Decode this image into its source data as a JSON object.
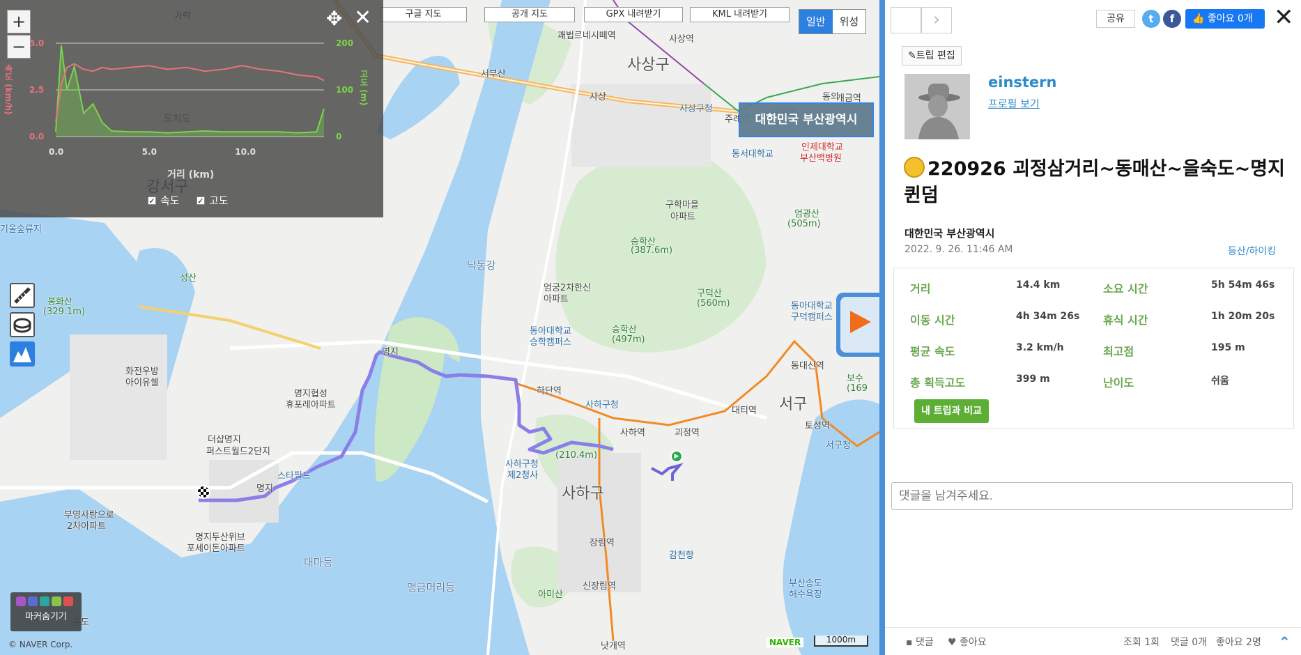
{
  "map": {
    "top_buttons": [
      "구글 지도",
      "공개 지도",
      "GPX 내려받기",
      "KML 내려받기"
    ],
    "map_type": {
      "normal": "일반",
      "satellite": "위성"
    },
    "place_badge": "대한민국 부산광역시",
    "marker_toggle_label": "마커숨기기",
    "copyright": "© NAVER Corp.",
    "naver_logo": "NAVER",
    "scale": "1000m",
    "zoom_in": "+",
    "zoom_out": "−",
    "labels": [
      {
        "text": "가락",
        "cls": ""
      },
      {
        "text": "서부산",
        "cls": ""
      },
      {
        "text": "사상",
        "cls": ""
      },
      {
        "text": "괘법르네시떼역",
        "cls": ""
      },
      {
        "text": "사상역",
        "cls": ""
      },
      {
        "text": "사상구",
        "cls": "big"
      },
      {
        "text": "사상구청",
        "cls": "blue"
      },
      {
        "text": "주례역",
        "cls": ""
      },
      {
        "text": "냉정역",
        "cls": ""
      },
      {
        "text": "개금역",
        "cls": ""
      },
      {
        "text": "동의",
        "cls": ""
      },
      {
        "text": "동서대학교",
        "cls": "blue"
      },
      {
        "text": "인제대학교",
        "cls": "red"
      },
      {
        "text": "부산백병원",
        "cls": "red"
      },
      {
        "text": "강서구",
        "cls": "big"
      },
      {
        "text": "기울숲류지",
        "cls": "blue"
      },
      {
        "text": "성산",
        "cls": "green"
      },
      {
        "text": "봉화산",
        "cls": "green"
      },
      {
        "text": "(329.1m)",
        "cls": "green"
      },
      {
        "text": "구학마을",
        "cls": ""
      },
      {
        "text": "아파트",
        "cls": ""
      },
      {
        "text": "엄광산",
        "cls": "green"
      },
      {
        "text": "(505m)",
        "cls": "green"
      },
      {
        "text": "승학산",
        "cls": "green"
      },
      {
        "text": "(387.6m)",
        "cls": "green"
      },
      {
        "text": "낙동강",
        "cls": "water"
      },
      {
        "text": "엄궁2차한신",
        "cls": ""
      },
      {
        "text": "아파트",
        "cls": ""
      },
      {
        "text": "구덕산",
        "cls": "green"
      },
      {
        "text": "(560m)",
        "cls": "green"
      },
      {
        "text": "동아대학교",
        "cls": "blue"
      },
      {
        "text": "구덕캠퍼스",
        "cls": "blue"
      },
      {
        "text": "승학산",
        "cls": "green"
      },
      {
        "text": "(497m)",
        "cls": "green"
      },
      {
        "text": "동아대학교",
        "cls": "blue"
      },
      {
        "text": "승학캠퍼스",
        "cls": "blue"
      },
      {
        "text": "화전우방",
        "cls": ""
      },
      {
        "text": "아이유쉘",
        "cls": ""
      },
      {
        "text": "명지",
        "cls": ""
      },
      {
        "text": "명지협성",
        "cls": ""
      },
      {
        "text": "휴포레아파트",
        "cls": ""
      },
      {
        "text": "동대신역",
        "cls": ""
      },
      {
        "text": "보수",
        "cls": "green"
      },
      {
        "text": "(169",
        "cls": "green"
      },
      {
        "text": "하단역",
        "cls": ""
      },
      {
        "text": "사하구청",
        "cls": "blue"
      },
      {
        "text": "사하역",
        "cls": ""
      },
      {
        "text": "괴정역",
        "cls": ""
      },
      {
        "text": "대티역",
        "cls": ""
      },
      {
        "text": "서구",
        "cls": "big"
      },
      {
        "text": "토성역",
        "cls": ""
      },
      {
        "text": "서구청",
        "cls": "blue"
      },
      {
        "text": "더샵명지",
        "cls": ""
      },
      {
        "text": "퍼스트월드2단지",
        "cls": ""
      },
      {
        "text": "스타필드",
        "cls": "blue"
      },
      {
        "text": "(210.4m)",
        "cls": "green"
      },
      {
        "text": "사하구청",
        "cls": "blue"
      },
      {
        "text": "제2청사",
        "cls": "blue"
      },
      {
        "text": "사하구",
        "cls": "big"
      },
      {
        "text": "명지",
        "cls": ""
      },
      {
        "text": "부영사랑으로",
        "cls": ""
      },
      {
        "text": "2차아파트",
        "cls": ""
      },
      {
        "text": "명지두산위브",
        "cls": ""
      },
      {
        "text": "포세이돈아파트",
        "cls": ""
      },
      {
        "text": "장림역",
        "cls": ""
      },
      {
        "text": "감천항",
        "cls": "blue"
      },
      {
        "text": "대마등",
        "cls": "water"
      },
      {
        "text": "맹금머리등",
        "cls": "water"
      },
      {
        "text": "아미산",
        "cls": "green"
      },
      {
        "text": "신장림역",
        "cls": ""
      },
      {
        "text": "부산송도",
        "cls": "blue"
      },
      {
        "text": "해수욕장",
        "cls": "blue"
      },
      {
        "text": "낫개역",
        "cls": ""
      },
      {
        "text": "우도",
        "cls": ""
      }
    ]
  },
  "chart": {
    "left_axis_ticks": [
      "5.0",
      "2.5",
      "0.0"
    ],
    "right_axis_ticks": [
      "200",
      "100",
      "0"
    ],
    "x_ticks": [
      "0.0",
      "5.0",
      "10.0"
    ],
    "x_label": "거리 (km)",
    "left_axis_label": "속도 (km/h)",
    "right_axis_label": "고도 (m)",
    "inner_label": "도치도",
    "speed_label": "속도",
    "elev_label": "고도",
    "colors": {
      "speed": "#e8737a",
      "elevation": "#7bd44a"
    }
  },
  "chart_data": {
    "type": "line",
    "xlabel": "거리 (km)",
    "x": [
      0,
      0.3,
      0.6,
      1,
      1.5,
      2,
      2.5,
      3,
      4,
      5,
      6,
      7,
      8,
      9,
      10,
      11,
      12,
      13,
      14,
      14.4
    ],
    "series": [
      {
        "name": "속도",
        "axis": "left",
        "values": [
          0.8,
          2.8,
          3.7,
          3.9,
          3.6,
          3.5,
          3.7,
          3.6,
          3.7,
          3.8,
          3.6,
          3.7,
          3.5,
          3.6,
          3.8,
          3.6,
          3.5,
          3.3,
          3.2,
          3.0
        ]
      },
      {
        "name": "고도",
        "axis": "right",
        "values": [
          10,
          195,
          100,
          150,
          50,
          70,
          30,
          12,
          10,
          10,
          8,
          10,
          12,
          10,
          10,
          10,
          10,
          8,
          10,
          60
        ]
      }
    ],
    "ylim_left": [
      0,
      5
    ],
    "ylim_right": [
      0,
      200
    ],
    "xlim": [
      0,
      14.4
    ]
  },
  "side": {
    "share": "공유",
    "like": "좋아요 0개",
    "trip_edit": "트립 편집",
    "username": "einstern",
    "profile_link": "프로필 보기",
    "title": "220926 괴정삼거리~동매산~을숙도~명지 퀸덤",
    "region": "대한민국 부산광역시",
    "datetime": "2022. 9. 26. 11:46 AM",
    "category": "등산/하이킹",
    "stats": [
      {
        "label": "거리",
        "value": "14.4 km"
      },
      {
        "label": "소요 시간",
        "value": "5h 54m 46s"
      },
      {
        "label": "이동 시간",
        "value": "4h 34m 26s"
      },
      {
        "label": "휴식 시간",
        "value": "1h 20m 20s"
      },
      {
        "label": "평균 속도",
        "value": "3.2 km/h"
      },
      {
        "label": "최고점",
        "value": "195 m"
      },
      {
        "label": "총 획득고도",
        "value": "399 m"
      },
      {
        "label": "난이도",
        "value": "쉬움"
      }
    ],
    "compare_button": "내 트립과 비교",
    "comment_placeholder": "댓글을 남겨주세요.",
    "footer": {
      "comment": "댓글",
      "like": "좋아요",
      "views": "조회 1회",
      "comments_count": "댓글 0개",
      "likes_count": "좋아요 2명"
    }
  }
}
